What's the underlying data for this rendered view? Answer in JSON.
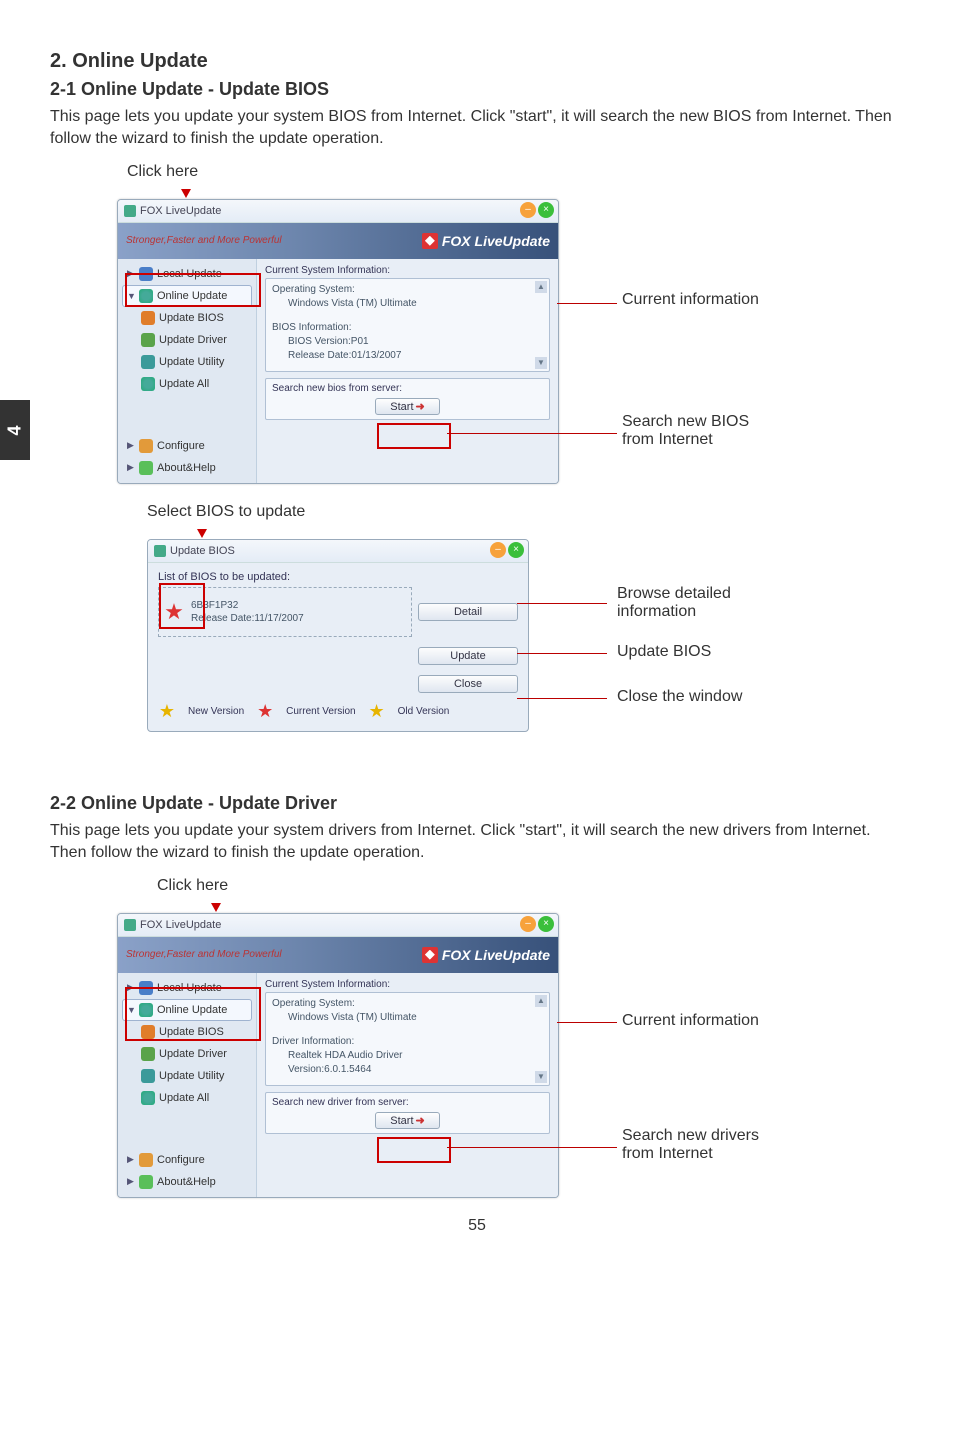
{
  "page_number": "55",
  "side_tab": "4",
  "section1": {
    "title": "2. Online Update",
    "subtitle": "2-1 Online Update - Update BIOS",
    "body": "This page lets you update your system BIOS from Internet. Click \"start\", it will search the new BIOS from Internet. Then follow the wizard to finish the update operation."
  },
  "fig1": {
    "click_here": "Click here",
    "window_title": "FOX LiveUpdate",
    "slogan": "Stronger,Faster and More Powerful",
    "brand": "FOX LiveUpdate",
    "sidebar": {
      "local_update": "Local Update",
      "online_update": "Online Update",
      "update_bios": "Update BIOS",
      "update_driver": "Update Driver",
      "update_utility": "Update Utility",
      "update_all": "Update All",
      "configure": "Configure",
      "about_help": "About&Help"
    },
    "panel_heading": "Current System Information:",
    "info": {
      "os_label": "Operating System:",
      "os_value": "Windows Vista (TM) Ultimate",
      "bios_label": "BIOS Information:",
      "bios_ver": "BIOS Version:P01",
      "bios_date": "Release Date:01/13/2007"
    },
    "search_label": "Search new bios from server:",
    "start_btn": "Start",
    "callout_current": "Current information",
    "callout_search1": "Search new BIOS",
    "callout_search2": "from Internet"
  },
  "fig2": {
    "select_label": "Select BIOS to update",
    "window_title": "Update BIOS",
    "list_label": "List of BIOS to be updated:",
    "item_name": "6B3F1P32",
    "item_date": "Release Date:11/17/2007",
    "btn_detail": "Detail",
    "btn_update": "Update",
    "btn_close": "Close",
    "legend_new": "New Version",
    "legend_current": "Current Version",
    "legend_old": "Old Version",
    "callout_detail1": "Browse detailed",
    "callout_detail2": "information",
    "callout_update": "Update BIOS",
    "callout_close": "Close the window"
  },
  "section2": {
    "subtitle": "2-2 Online Update - Update Driver",
    "body": "This page lets you update your system drivers from Internet. Click \"start\", it will search the new drivers from Internet. Then follow the wizard to finish the update operation."
  },
  "fig3": {
    "click_here": "Click here",
    "window_title": "FOX LiveUpdate",
    "slogan": "Stronger,Faster and More Powerful",
    "brand": "FOX LiveUpdate",
    "panel_heading": "Current System Information:",
    "info": {
      "os_label": "Operating System:",
      "os_value": "Windows Vista (TM) Ultimate",
      "drv_label": "Driver Information:",
      "drv_name": "Realtek HDA Audio Driver",
      "drv_ver": "Version:6.0.1.5464"
    },
    "search_label": "Search new driver from server:",
    "start_btn": "Start",
    "callout_current": "Current information",
    "callout_search1": "Search new drivers",
    "callout_search2": "from Internet"
  }
}
